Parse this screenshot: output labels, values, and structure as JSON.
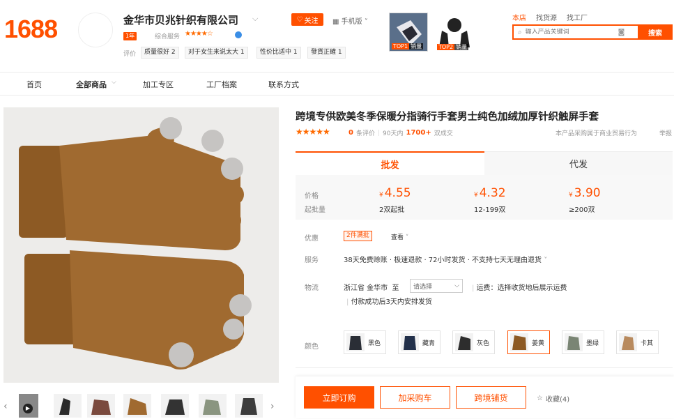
{
  "header": {
    "logo": "1688",
    "shop_name": "金华市贝兆针织有限公司",
    "follow_label": "关注",
    "mobile_label": "手机版",
    "years_badge": "1年",
    "service_label": "综合服务",
    "rating_label": "评价",
    "tags": [
      "质量很好 2",
      "对于女生来说太大 1",
      "性价比适中 1",
      "發貨正確 1"
    ],
    "top_products": [
      {
        "rank": "TOP1",
        "label": "销量"
      },
      {
        "rank": "TOP2",
        "label": "销量"
      }
    ],
    "search_tabs": [
      "本店",
      "找货源",
      "找工厂"
    ],
    "search_placeholder": "输入产品关键词",
    "search_button": "搜索"
  },
  "nav": [
    "首页",
    "全部商品",
    "加工专区",
    "工厂档案",
    "联系方式"
  ],
  "product": {
    "title": "跨境专供欧美冬季保暖分指骑行手套男士纯色加绒加厚针织触屏手套",
    "review_count": "0",
    "review_suffix": "条评价",
    "days_label": "90天内",
    "sold_count": "1700+",
    "sold_suffix": "双成交",
    "trade_note": "本产品采购属于商业贸易行为",
    "report_label": "举报",
    "tabs": [
      "批发",
      "代发"
    ],
    "price_label": "价格",
    "moq_label": "起批量",
    "currency": "¥",
    "prices": [
      {
        "price": "4.55",
        "qty": "2双起批"
      },
      {
        "price": "4.32",
        "qty": "12-199双"
      },
      {
        "price": "3.90",
        "qty": "≥200双"
      }
    ],
    "promo_label": "优惠",
    "promo_tag": "2件满批",
    "promo_view": "查看",
    "service_label": "服务",
    "service_text": "38天免费赊账 · 极速退款 · 72小时发货 · 不支持七天无理由退货",
    "logistics_label": "物流",
    "origin": "浙江省 金华市",
    "to_label": "至",
    "select_placeholder": "请选择",
    "freight_text": "运费：选择收货地后展示运费",
    "ship_text": "付款成功后3天内安排发货",
    "color_label": "颜色",
    "colors": [
      "黑色",
      "藏青",
      "灰色",
      "姜黄",
      "墨绿",
      "卡其"
    ],
    "buttons": {
      "order": "立即订购",
      "cart": "加采购车",
      "crossborder": "跨境铺货",
      "favorite": "收藏(4)"
    }
  },
  "colors": {
    "brand": "#ff5000",
    "glove_brown": "#a0692f",
    "tip_grey": "#c8c8c8"
  }
}
